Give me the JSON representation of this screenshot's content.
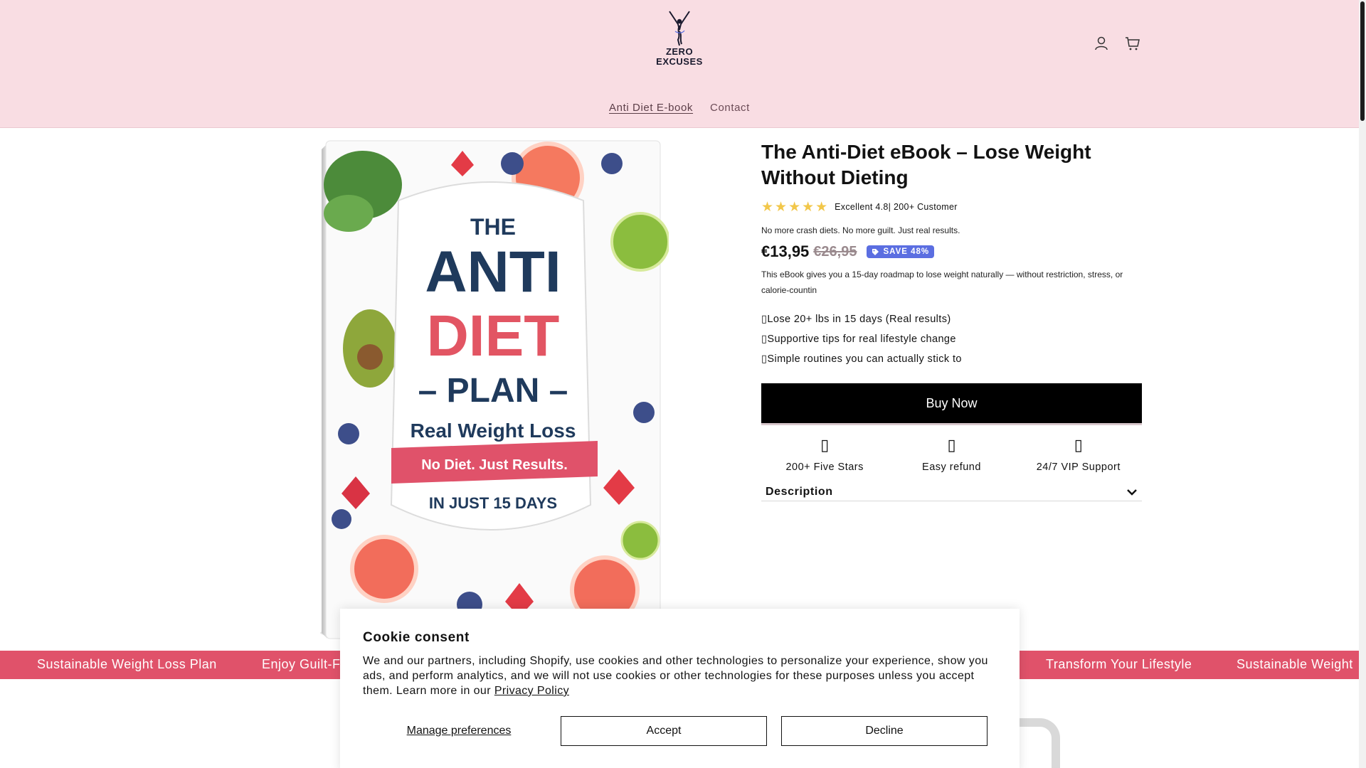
{
  "header": {
    "logo_line1": "ZERO",
    "logo_line2": "EXCUSES",
    "nav": [
      {
        "label": "Anti Diet E-book"
      },
      {
        "label": "Contact"
      }
    ]
  },
  "product": {
    "cover": {
      "line1": "THE",
      "line2": "ANTI",
      "line3": "DIET",
      "line4": "– PLAN –",
      "subtitle": "Real Weight Loss",
      "ribbon": "No Diet. Just Results.",
      "days": "IN JUST 15 DAYS"
    },
    "title": "The Anti-Diet eBook – Lose Weight Without Dieting",
    "stars": "★★★★★",
    "rating_text": "Excellent 4.8| 200+ Customer",
    "tagline": "No more crash diets. No more guilt. Just real results.",
    "price": "€13,95",
    "compare_price": "€26,95",
    "badge": "SAVE 48%",
    "description": "This eBook gives you a 15-day roadmap to lose weight naturally — without restriction, stress, or calorie-countin",
    "bullets": [
      "Lose 20+ lbs in 15 days (Real results)",
      "Supportive tips for real lifestyle change",
      "Simple routines you can actually stick to"
    ],
    "buy_label": "Buy Now",
    "features": [
      {
        "label": "200+ Five Stars"
      },
      {
        "label": "Easy refund"
      },
      {
        "label": "24/7 VIP Support"
      }
    ],
    "accordion_label": "Description"
  },
  "marquee": {
    "items": [
      "Sustainable Weight Loss Plan",
      "Enjoy Guilt-F",
      "Transform Your Lifestyle",
      "Sustainable Weight"
    ]
  },
  "cookie": {
    "title": "Cookie consent",
    "text": "We and our partners, including Shopify, use cookies and other technologies to personalize your experience, show you ads, and perform analytics, and we will not use cookies or other technologies for these purposes unless you accept them. Learn more in our",
    "link": "Privacy Policy",
    "manage": "Manage preferences",
    "accept": "Accept",
    "decline": "Decline"
  },
  "colors": {
    "header_bg": "#f9dde3",
    "marquee_bg": "#e0526a",
    "badge_bg": "#5b6ee1",
    "star": "#f2c74a"
  }
}
